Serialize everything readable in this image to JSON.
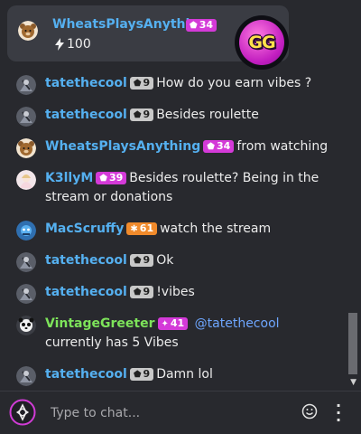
{
  "pinned": {
    "username": "WheatsPlaysAnything",
    "badge": "34",
    "amount": "100",
    "logo_text": "GG",
    "user_color": "#55b0f0"
  },
  "messages": [
    {
      "user": "tatethecool",
      "badge": "9",
      "text": "How do you earn vibes ?"
    },
    {
      "user": "tatethecool",
      "badge": "9",
      "text": "Besides roulette"
    },
    {
      "user": "WheatsPlaysAnything",
      "badge": "34",
      "text": "from watching"
    },
    {
      "user": "K3llyM",
      "badge": "39",
      "text": "Besides roulette? Being in the stream or donations"
    },
    {
      "user": "MacScruffy",
      "badge": "61",
      "text": "watch the stream"
    },
    {
      "user": "tatethecool",
      "badge": "9",
      "text": "Ok"
    },
    {
      "user": "tatethecool",
      "badge": "9",
      "text": "!vibes"
    },
    {
      "user": "VintageGreeter",
      "badge": "41",
      "mention": "@tatethecool",
      "text": "currently has 5 Vibes"
    },
    {
      "user": "tatethecool",
      "badge": "9",
      "text": "Damn lol"
    }
  ],
  "colors": {
    "user_blue": "#55b0f0",
    "user_green": "#7de35a",
    "badge_pink": "#d43ad8",
    "badge_gray": "#c8c8c8",
    "badge_orange": "#f08a2b",
    "mention": "#6ea6ff"
  },
  "chat_input": {
    "placeholder": "Type to chat..."
  },
  "icons": [
    "gem-icon",
    "bolt-icon",
    "star-icon",
    "emoji-icon",
    "more-vertical-icon",
    "app-logo-icon",
    "chevron-down-icon"
  ]
}
